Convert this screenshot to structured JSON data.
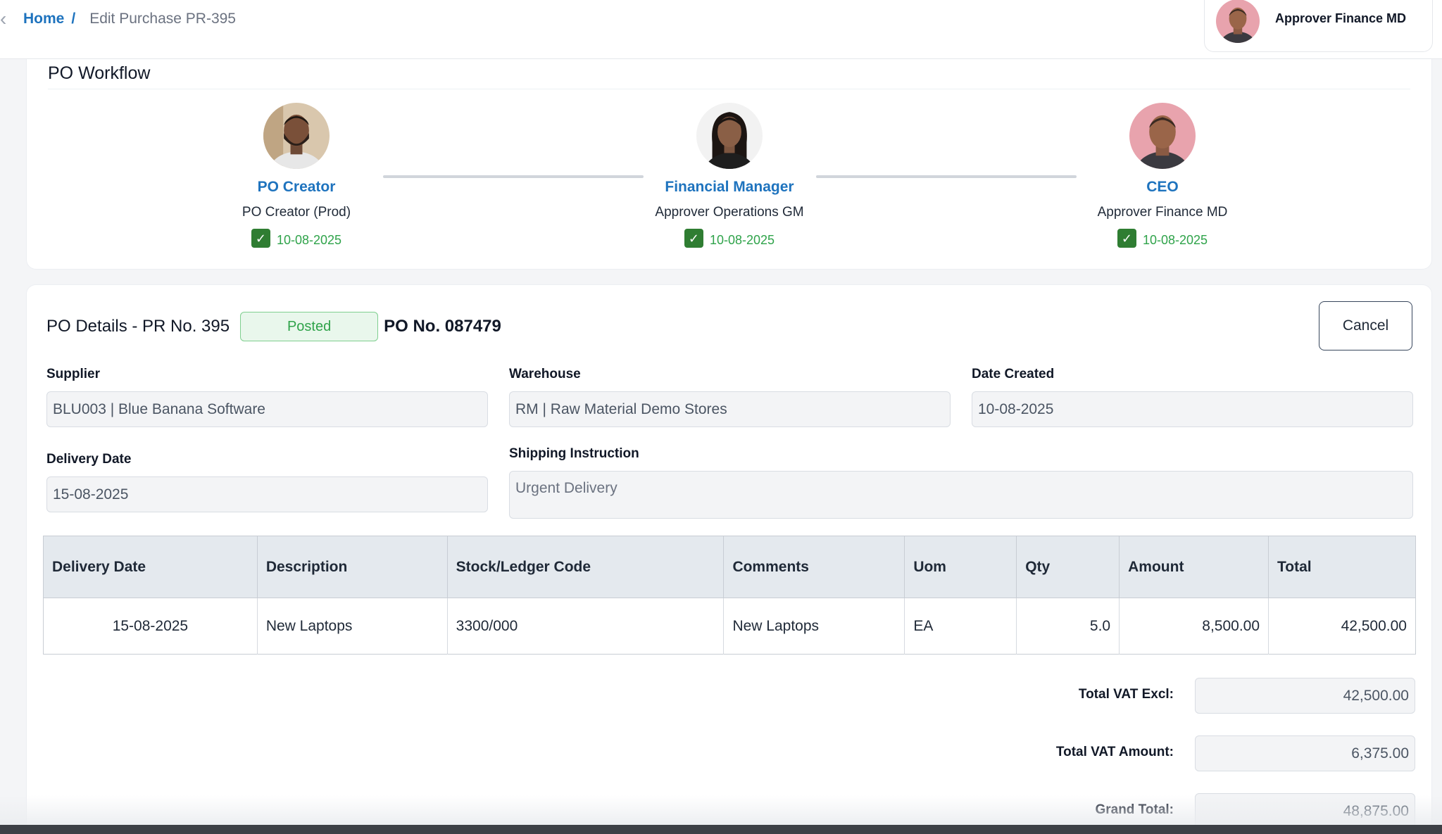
{
  "breadcrumb": {
    "home": "Home",
    "separator": "/",
    "current": "Edit Purchase PR-395"
  },
  "user": {
    "name": "Approver Finance MD",
    "avatar_icon": "avatar-man-pink-bg"
  },
  "workflow": {
    "title": "PO Workflow",
    "steps": [
      {
        "role": "PO Creator",
        "person": "PO Creator (Prod)",
        "date": "10-08-2025",
        "checked": true,
        "avatar_icon": "avatar-man-beard"
      },
      {
        "role": "Financial Manager",
        "person": "Approver Operations GM",
        "date": "10-08-2025",
        "checked": true,
        "avatar_icon": "avatar-woman"
      },
      {
        "role": "CEO",
        "person": "Approver Finance MD",
        "date": "10-08-2025",
        "checked": true,
        "avatar_icon": "avatar-man-pink-bg"
      }
    ]
  },
  "details": {
    "title": "PO Details - PR No. 395",
    "status": "Posted",
    "po_number": "PO No. 087479",
    "cancel_label": "Cancel",
    "supplier_label": "Supplier",
    "supplier_value": "BLU003 | Blue Banana Software",
    "warehouse_label": "Warehouse",
    "warehouse_value": "RM | Raw Material Demo Stores",
    "date_created_label": "Date Created",
    "date_created_value": "10-08-2025",
    "delivery_date_label": "Delivery Date",
    "delivery_date_value": "15-08-2025",
    "shipping_label": "Shipping Instruction",
    "shipping_value": "Urgent Delivery"
  },
  "table": {
    "columns": [
      "Delivery Date",
      "Description",
      "Stock/Ledger Code",
      "Comments",
      "Uom",
      "Qty",
      "Amount",
      "Total"
    ],
    "rows": [
      [
        "15-08-2025",
        "New Laptops",
        "3300/000",
        "New Laptops",
        "EA",
        "5.0",
        "8,500.00",
        "42,500.00"
      ]
    ]
  },
  "totals": {
    "vat_excl_label": "Total VAT Excl:",
    "vat_excl_value": "42,500.00",
    "vat_amount_label": "Total VAT Amount:",
    "vat_amount_value": "6,375.00",
    "grand_total_label": "Grand Total:",
    "grand_total_value": "48,875.00"
  },
  "colors": {
    "link": "#1e73be",
    "success": "#2fa34a",
    "check": "#2f7d32",
    "header_bg": "#e4e9ee"
  }
}
